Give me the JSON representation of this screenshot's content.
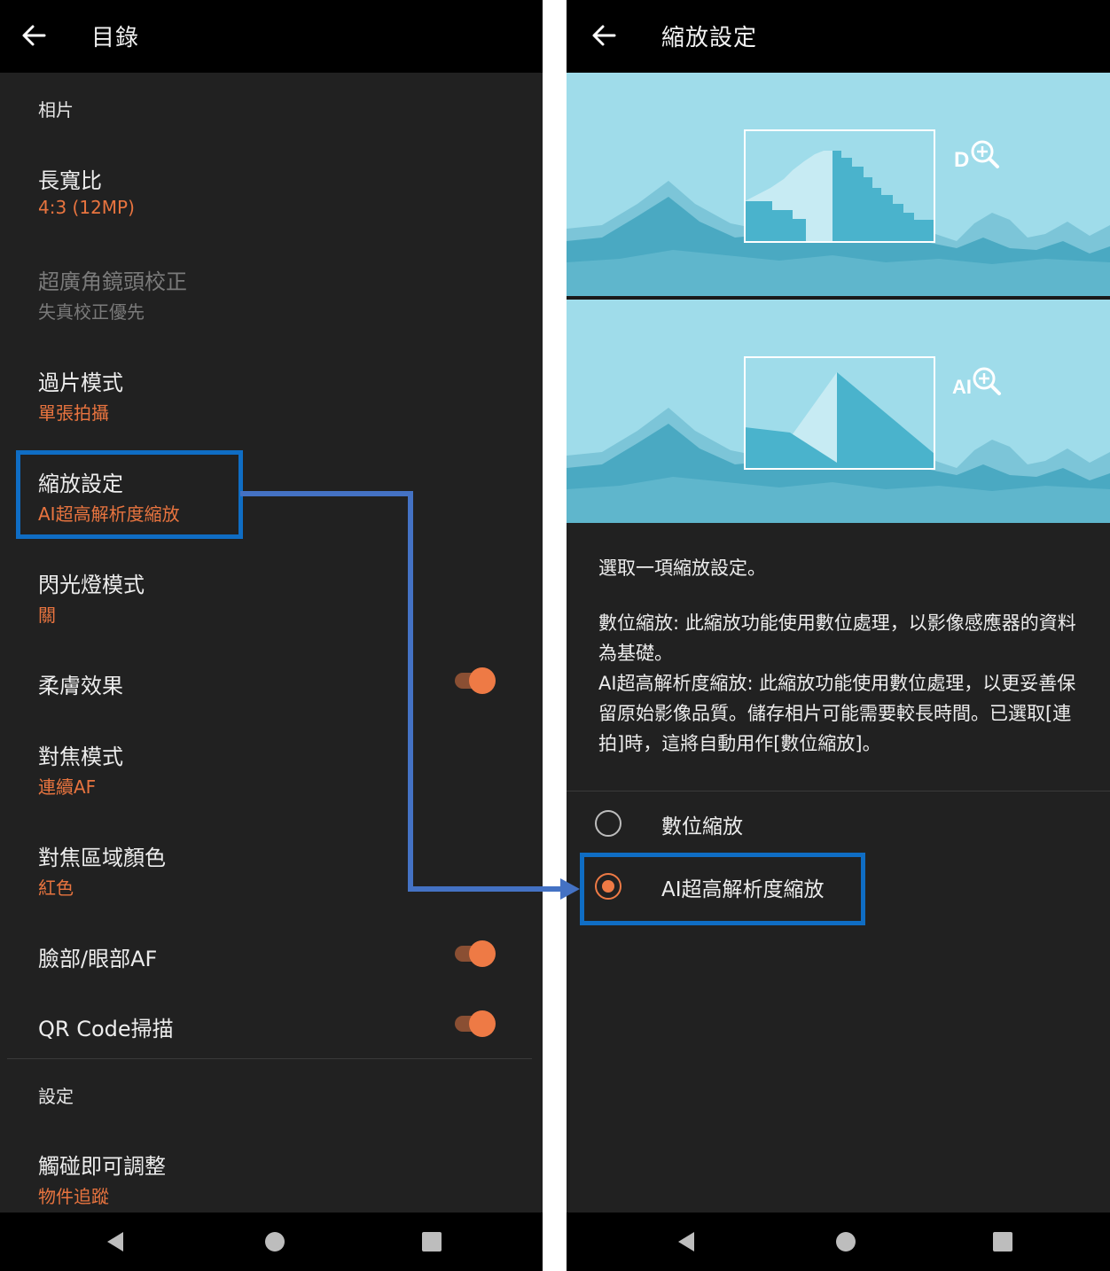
{
  "left": {
    "title": "目錄",
    "section_photo": "相片",
    "items": [
      {
        "title": "長寬比",
        "sub": "4:3 (12MP)"
      },
      {
        "title": "超廣角鏡頭校正",
        "sub": "失真校正優先"
      },
      {
        "title": "過片模式",
        "sub": "單張拍攝"
      },
      {
        "title": "縮放設定",
        "sub": "AI超高解析度縮放"
      },
      {
        "title": "閃光燈模式",
        "sub": "關"
      },
      {
        "title": "柔膚效果"
      },
      {
        "title": "對焦模式",
        "sub": "連續AF"
      },
      {
        "title": "對焦區域顏色",
        "sub": "紅色"
      },
      {
        "title": "臉部/眼部AF"
      },
      {
        "title": "QR Code掃描"
      }
    ],
    "toggles": {
      "soft_skin": true,
      "face_eye_af": true,
      "qr_code": true
    },
    "section_settings": "設定",
    "touch_item": {
      "title": "觸碰即可調整",
      "sub": "物件追蹤"
    }
  },
  "right": {
    "title": "縮放設定",
    "illustration": {
      "digital_badge": "D",
      "ai_badge": "AI"
    },
    "desc_intro": "選取一項縮放設定。",
    "desc_body": "數位縮放: 此縮放功能使用數位處理，以影像感應器的資料為基礎。\nAI超高解析度縮放: 此縮放功能使用數位處理，以更妥善保留原始影像品質。儲存相片可能需要較長時間。已選取[連拍]時，這將自動用作[數位縮放]。",
    "options": [
      {
        "label": "數位縮放",
        "selected": false
      },
      {
        "label": "AI超高解析度縮放",
        "selected": true
      }
    ]
  },
  "colors": {
    "accent": "#ee7a45",
    "highlight": "#0f6dc4",
    "arrow": "#4472c4",
    "background": "#212121",
    "sky": "#9fdcea",
    "mountain": "#4aa9c2"
  }
}
